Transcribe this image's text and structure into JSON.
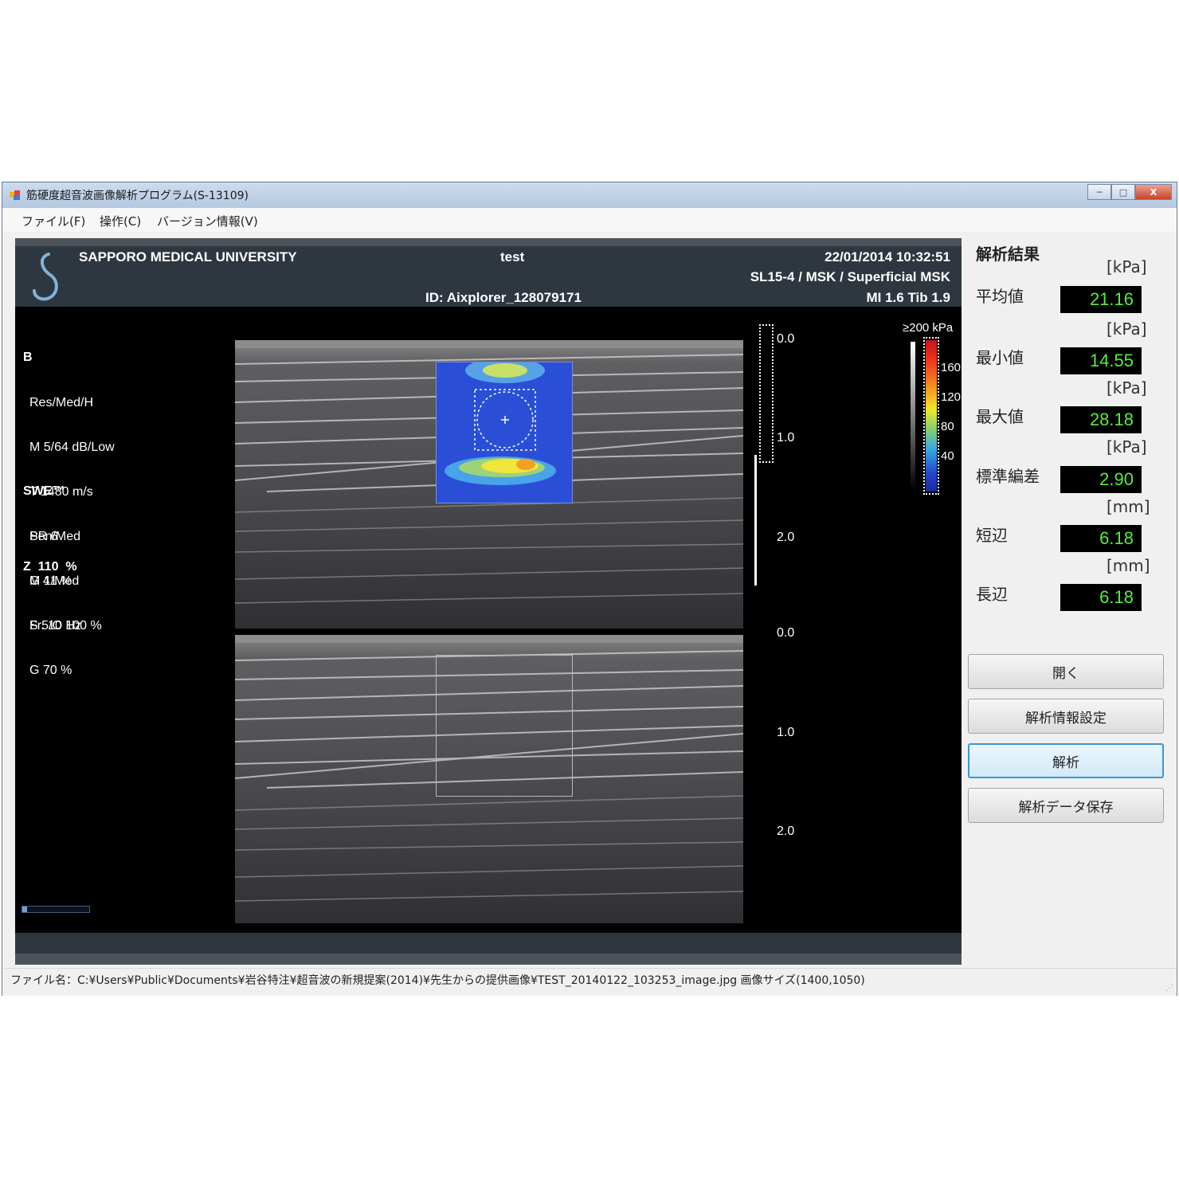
{
  "window": {
    "title": "筋硬度超音波画像解析プログラム(S-13109)",
    "controls": {
      "minimize": "─",
      "maximize": "□",
      "close": "X"
    }
  },
  "menu": {
    "file": "ファイル(F)",
    "operation": "操作(C)",
    "version": "バージョン情報(V)"
  },
  "ultrasound": {
    "institution": "SAPPORO MEDICAL UNIVERSITY",
    "patient": "test",
    "datetime": "22/01/2014 10:32:51",
    "probe": "SL15-4 / MSK / Superficial MSK",
    "id": "ID: Aixplorer_128079171",
    "indices": "MI 1.6  Tib 1.9",
    "bmode": {
      "title": "B",
      "lines": [
        "Res/Med/H",
        "M 5/64 dB/Low",
        "T 1480 m/s",
        "SR 6",
        "G 41 %",
        "Fr. 10 Hz"
      ]
    },
    "swe": {
      "title": "SWE™",
      "lines": [
        "Pen/Med",
        "M 1/Med",
        "S 5/O 100 %",
        "G 70 %"
      ]
    },
    "zoom": "Z  110  %",
    "scale_top": [
      "0.0",
      "1.0",
      "2.0"
    ],
    "scale_bottom": [
      "0.0",
      "1.0",
      "2.0"
    ],
    "colorbar": {
      "max_label": "≥200 kPa",
      "ticks": [
        "160",
        "120",
        "80",
        "40"
      ]
    }
  },
  "results": {
    "title": "解析結果",
    "items": [
      {
        "label": "平均値",
        "unit": "[kPa]",
        "value": "21.16"
      },
      {
        "label": "最小値",
        "unit": "[kPa]",
        "value": "14.55"
      },
      {
        "label": "最大値",
        "unit": "[kPa]",
        "value": "28.18"
      },
      {
        "label": "標準編差",
        "unit": "[kPa]",
        "value": "2.90"
      },
      {
        "label": "短辺",
        "unit": "[mm]",
        "value": "6.18"
      },
      {
        "label": "長辺",
        "unit": "[mm]",
        "value": "6.18"
      }
    ],
    "value_color": "#55ee3a"
  },
  "buttons": {
    "open": "開く",
    "settings": "解析情報設定",
    "analyze": "解析",
    "save": "解析データ保存"
  },
  "status": {
    "text": "ファイル名：C:¥Users¥Public¥Documents¥岩谷特注¥超音波の新規提案(2014)¥先生からの提供画像¥TEST_20140122_103253_image.jpg  画像サイズ(1400,1050)"
  }
}
